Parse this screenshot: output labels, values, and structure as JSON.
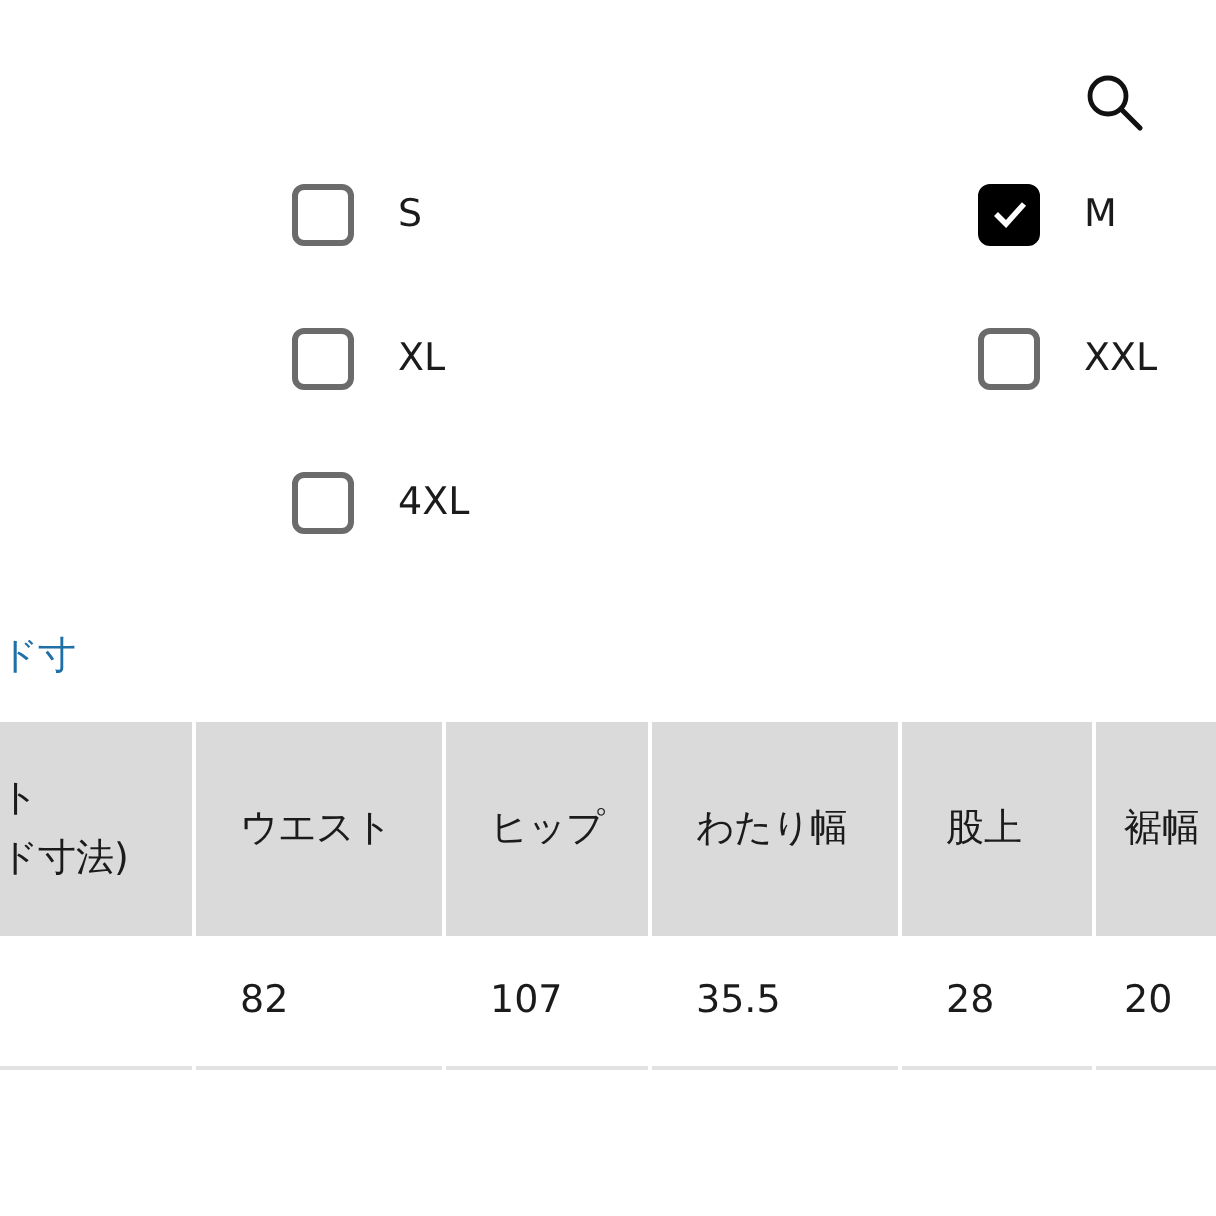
{
  "sizes": [
    {
      "label": "S",
      "checked": false
    },
    {
      "label": "M",
      "checked": true
    },
    {
      "label": "XL",
      "checked": false
    },
    {
      "label": "XXL",
      "checked": false
    },
    {
      "label": "4XL",
      "checked": false
    }
  ],
  "size_link": "ド寸",
  "table": {
    "columns": [
      {
        "lines": [
          "ト",
          "ド寸法)"
        ]
      },
      {
        "lines": [
          "ウエスト"
        ]
      },
      {
        "lines": [
          "ヒップ"
        ]
      },
      {
        "lines": [
          "わたり幅"
        ]
      },
      {
        "lines": [
          "股上"
        ]
      },
      {
        "lines": [
          "裾幅"
        ]
      }
    ],
    "rows": [
      [
        "",
        "82",
        "107",
        "35.5",
        "28",
        "20"
      ]
    ]
  }
}
